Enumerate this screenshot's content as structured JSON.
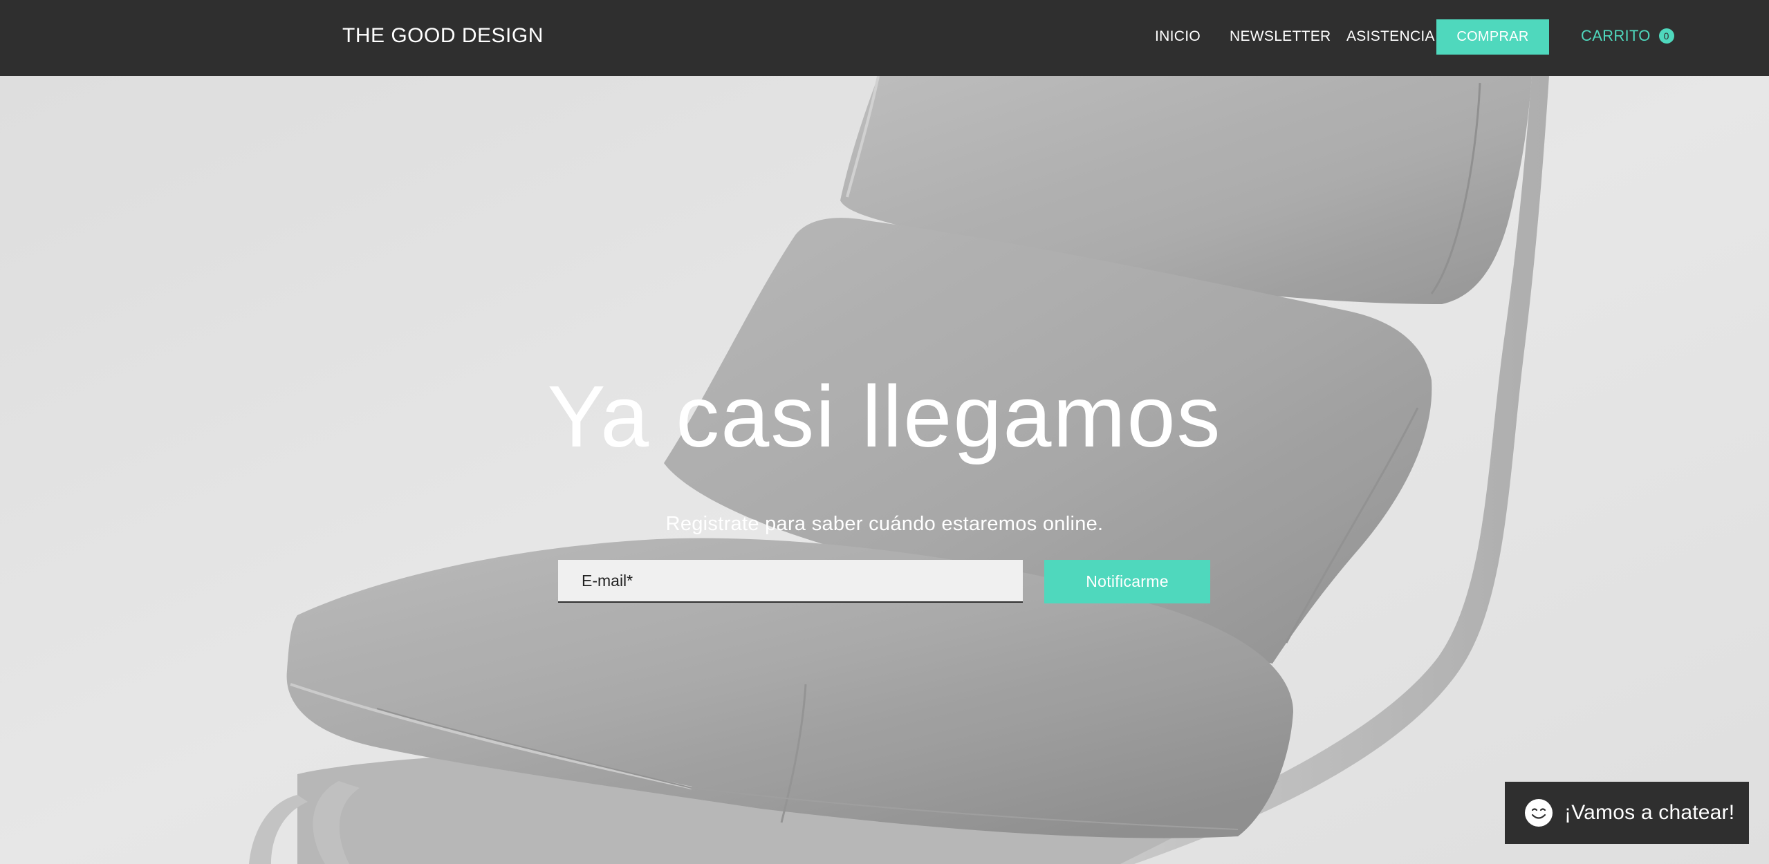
{
  "header": {
    "brand": "THE GOOD DESIGN",
    "nav": {
      "inicio": "INICIO",
      "newsletter": "NEWSLETTER",
      "asistencia": "ASISTENCIA"
    },
    "shop_button": "COMPRAR",
    "cart": {
      "label": "CARRITO",
      "count": "0"
    }
  },
  "hero": {
    "title": "Ya casi llegamos",
    "subtitle": "Registrate para saber cuándo estaremos online.",
    "email_placeholder": "E-mail*",
    "email_value": "",
    "notify_button": "Notificarme",
    "image_icon": "armchair-cushions-photo"
  },
  "chat": {
    "label": "¡Vamos a chatear!",
    "icon": "smiley-chat-icon"
  },
  "colors": {
    "header_bg": "#2f2f2f",
    "accent": "#4fd8bd",
    "text_light": "#ffffff"
  }
}
